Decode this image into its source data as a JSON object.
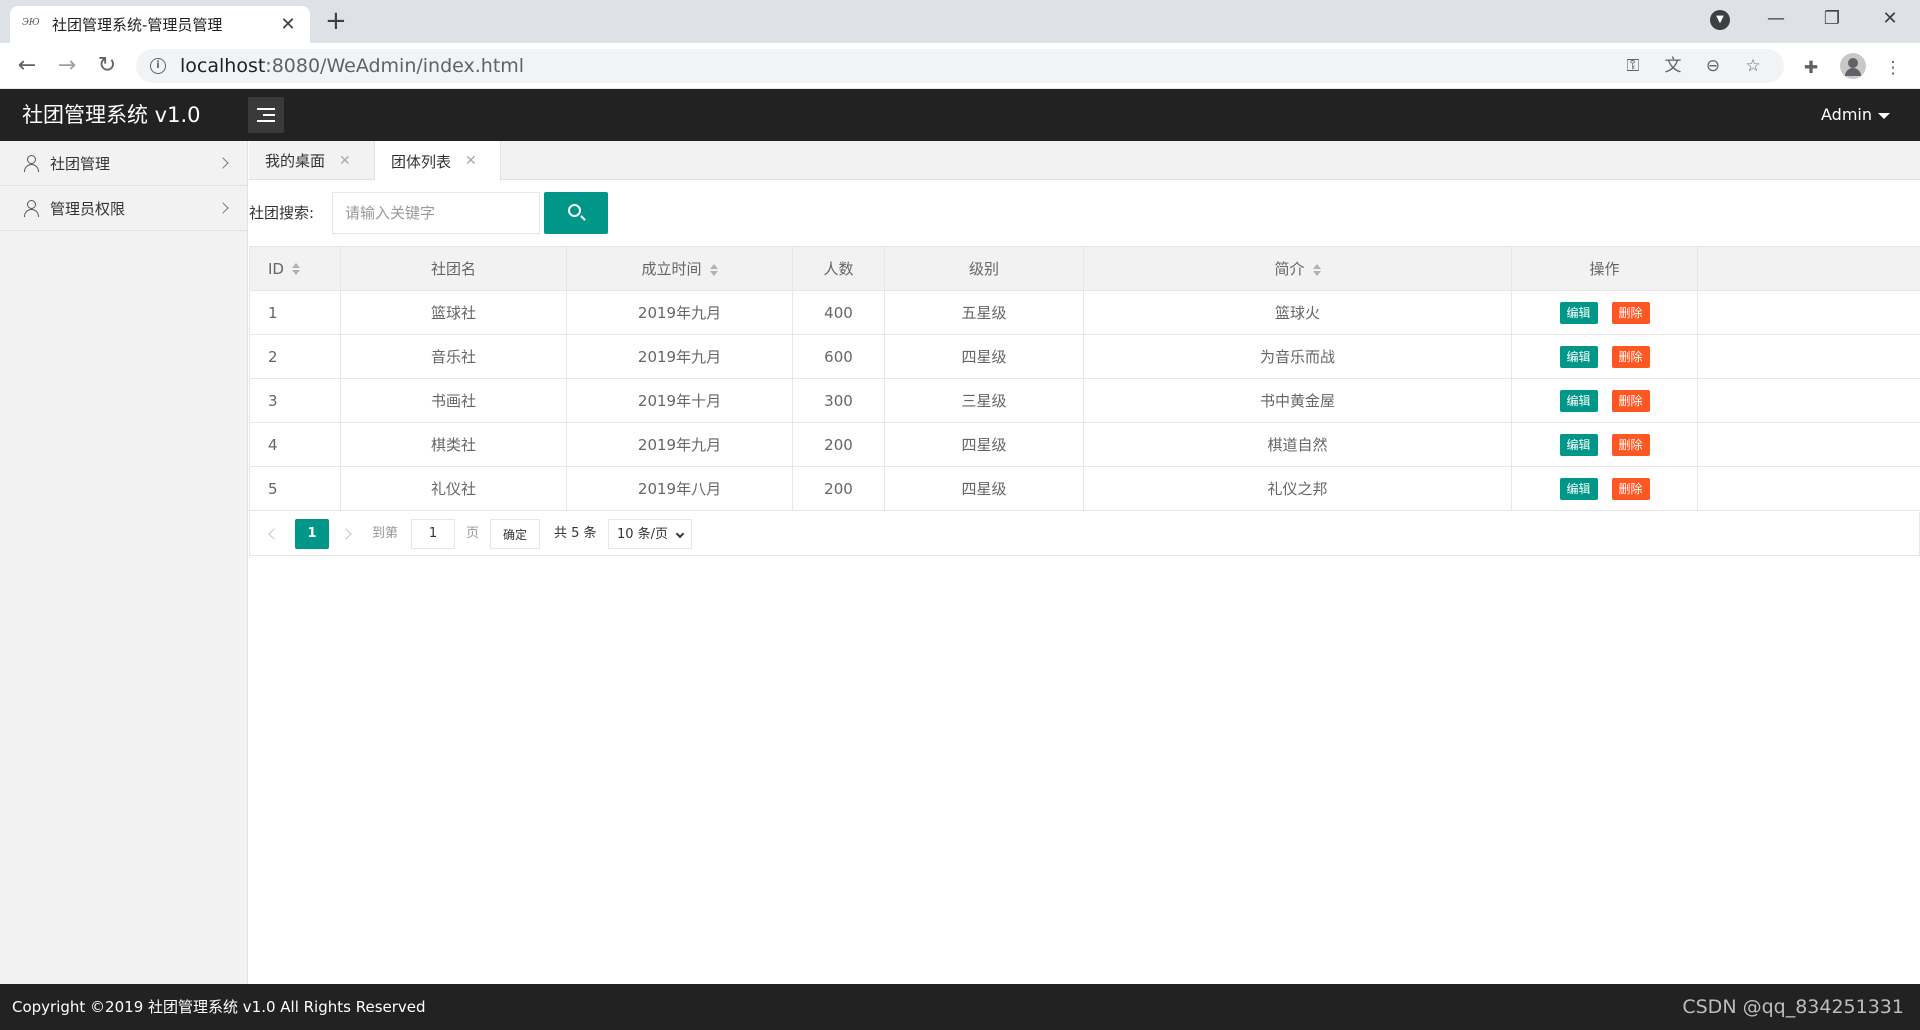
{
  "browser": {
    "tab_title": "社团管理系统-管理员管理",
    "favicon_text": "ЭЮ",
    "url_host": "localhost",
    "url_rest": ":8080/WeAdmin/index.html"
  },
  "app": {
    "logo": "社团管理系统 v1.0",
    "user": "Admin"
  },
  "sidebar": {
    "items": [
      {
        "label": "社团管理"
      },
      {
        "label": "管理员权限"
      }
    ]
  },
  "tabs": [
    {
      "label": "我的桌面"
    },
    {
      "label": "团体列表"
    }
  ],
  "search": {
    "label": "社团搜索:",
    "placeholder": "请输入关键字"
  },
  "table": {
    "headers": [
      "ID",
      "社团名",
      "成立时间",
      "人数",
      "级别",
      "简介",
      "操作"
    ],
    "rows": [
      {
        "id": "1",
        "name": "篮球社",
        "date": "2019年九月",
        "count": "400",
        "level": "五星级",
        "intro": "篮球火"
      },
      {
        "id": "2",
        "name": "音乐社",
        "date": "2019年九月",
        "count": "600",
        "level": "四星级",
        "intro": "为音乐而战"
      },
      {
        "id": "3",
        "name": "书画社",
        "date": "2019年十月",
        "count": "300",
        "level": "三星级",
        "intro": "书中黄金屋"
      },
      {
        "id": "4",
        "name": "棋类社",
        "date": "2019年九月",
        "count": "200",
        "level": "四星级",
        "intro": "棋道自然"
      },
      {
        "id": "5",
        "name": "礼仪社",
        "date": "2019年八月",
        "count": "200",
        "level": "四星级",
        "intro": "礼仪之邦"
      }
    ],
    "edit_label": "编辑",
    "delete_label": "删除"
  },
  "pager": {
    "current": "1",
    "goto_label": "到第",
    "goto_value": "1",
    "page_label": "页",
    "confirm_label": "确定",
    "total": "共 5 条",
    "page_size": "10 条/页"
  },
  "footer": {
    "copyright": "Copyright ©2019 社团管理系统 v1.0 All Rights Reserved",
    "watermark": "CSDN @qq_834251331"
  },
  "colors": {
    "primary": "#009688",
    "danger": "#ff5722",
    "header_bg": "#222222"
  }
}
